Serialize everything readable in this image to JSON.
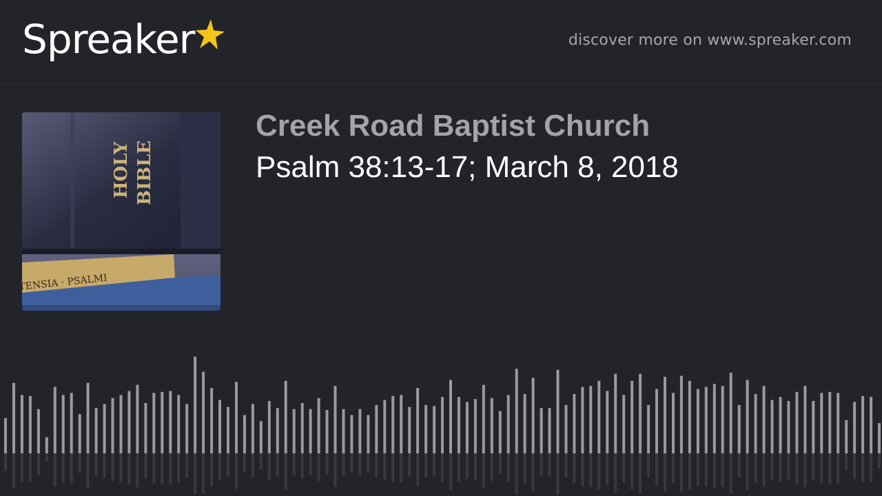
{
  "header": {
    "logo_text": "Spreaker",
    "logo_star_color": "#f5c419",
    "discover_text": "discover more on www.spreaker.com"
  },
  "cover": {
    "spine_text_1": "HOLY",
    "spine_text_2": "BIBLE",
    "book_label": "TENSIA · PSALMI"
  },
  "podcast": {
    "title": "Creek Road Baptist Church",
    "episode": "Psalm 38:13-17; March 8, 2018"
  },
  "waveform": {
    "bar_color": "#9a9ba0",
    "levels": [
      0.35,
      0.7,
      0.58,
      0.57,
      0.44,
      0.16,
      0.66,
      0.58,
      0.6,
      0.39,
      0.7,
      0.45,
      0.49,
      0.55,
      0.58,
      0.62,
      0.68,
      0.5,
      0.6,
      0.61,
      0.62,
      0.58,
      0.49,
      0.96,
      0.81,
      0.65,
      0.53,
      0.46,
      0.71,
      0.38,
      0.49,
      0.32,
      0.52,
      0.45,
      0.72,
      0.44,
      0.5,
      0.44,
      0.55,
      0.43,
      0.67,
      0.44,
      0.38,
      0.44,
      0.38,
      0.48,
      0.53,
      0.57,
      0.58,
      0.46,
      0.65,
      0.48,
      0.47,
      0.56,
      0.73,
      0.56,
      0.51,
      0.54,
      0.68,
      0.55,
      0.42,
      0.58,
      0.84,
      0.59,
      0.75,
      0.45,
      0.45,
      0.83,
      0.48,
      0.59,
      0.66,
      0.67,
      0.72,
      0.62,
      0.79,
      0.58,
      0.72,
      0.79,
      0.48,
      0.64,
      0.76,
      0.6,
      0.77,
      0.72,
      0.64,
      0.66,
      0.69,
      0.67,
      0.8,
      0.48,
      0.73,
      0.59,
      0.67,
      0.53,
      0.56,
      0.52,
      0.61,
      0.67,
      0.52,
      0.6,
      0.61,
      0.6,
      0.33,
      0.51,
      0.57,
      0.56,
      0.3
    ]
  }
}
